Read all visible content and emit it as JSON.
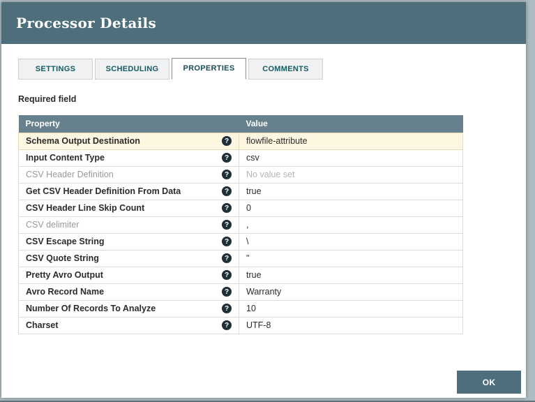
{
  "dialog": {
    "title": "Processor Details",
    "required_field_label": "Required field",
    "ok_label": "OK"
  },
  "tabs": [
    {
      "label": "SETTINGS",
      "active": false
    },
    {
      "label": "SCHEDULING",
      "active": false
    },
    {
      "label": "PROPERTIES",
      "active": true
    },
    {
      "label": "COMMENTS",
      "active": false
    }
  ],
  "table": {
    "columns": [
      "Property",
      "Value"
    ],
    "help_icon": "?",
    "rows": [
      {
        "property": "Schema Output Destination",
        "value": "flowfile-attribute",
        "highlighted": true,
        "muted": false,
        "value_unset": false
      },
      {
        "property": "Input Content Type",
        "value": "csv",
        "highlighted": false,
        "muted": false,
        "value_unset": false
      },
      {
        "property": "CSV Header Definition",
        "value": "No value set",
        "highlighted": false,
        "muted": true,
        "value_unset": true
      },
      {
        "property": "Get CSV Header Definition From Data",
        "value": "true",
        "highlighted": false,
        "muted": false,
        "value_unset": false
      },
      {
        "property": "CSV Header Line Skip Count",
        "value": "0",
        "highlighted": false,
        "muted": false,
        "value_unset": false
      },
      {
        "property": "CSV delimiter",
        "value": ",",
        "highlighted": false,
        "muted": true,
        "value_unset": false
      },
      {
        "property": "CSV Escape String",
        "value": "\\",
        "highlighted": false,
        "muted": false,
        "value_unset": false
      },
      {
        "property": "CSV Quote String",
        "value": "\"",
        "highlighted": false,
        "muted": false,
        "value_unset": false
      },
      {
        "property": "Pretty Avro Output",
        "value": "true",
        "highlighted": false,
        "muted": false,
        "value_unset": false
      },
      {
        "property": "Avro Record Name",
        "value": "Warranty",
        "highlighted": false,
        "muted": false,
        "value_unset": false
      },
      {
        "property": "Number Of Records To Analyze",
        "value": "10",
        "highlighted": false,
        "muted": false,
        "value_unset": false
      },
      {
        "property": "Charset",
        "value": "UTF-8",
        "highlighted": false,
        "muted": false,
        "value_unset": false
      }
    ]
  },
  "colors": {
    "header_teal": "#4d6e7a",
    "table_header_teal": "#66818d",
    "highlight_row": "#fdf6e0",
    "tab_text": "#155b63"
  }
}
